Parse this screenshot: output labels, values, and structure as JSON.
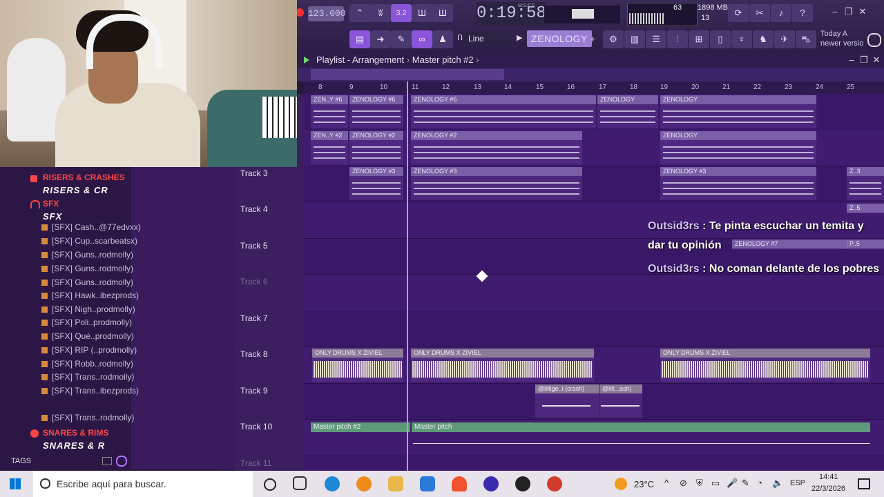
{
  "toolbar": {
    "tempo": "123.000",
    "time": "0:19:58",
    "time_unit": "M:S:CS",
    "pattern_btn": "3.2",
    "cpu": "63",
    "memory": "1898 MB",
    "polyphony": "13",
    "snap": "Line",
    "plugin": "ZENOLOGY",
    "news_line1": "Today  A",
    "news_line2": "newer versio"
  },
  "playlist": {
    "title": "Playlist - Arrangement",
    "pattern": "Master pitch #2",
    "ruler": [
      "8",
      "9",
      "10",
      "11",
      "12",
      "13",
      "14",
      "15",
      "16",
      "17",
      "18",
      "19",
      "20",
      "21",
      "22",
      "23",
      "24",
      "25"
    ],
    "tracks": [
      "Track 3",
      "Track 4",
      "Track 5",
      "Track 6",
      "Track 7",
      "Track 8",
      "Track 9",
      "Track 10",
      "Track 11"
    ],
    "clips": {
      "zen_y6": "ZEN..Y #6",
      "zenology6": "ZENOLOGY #6",
      "zenology": "ZENOLOGY",
      "zen_y2": "ZEN..Y #2",
      "zenology2": "ZENOLOGY #2",
      "zenology3": "ZENOLOGY #3",
      "z3": "Z..3",
      "z5": "Z..5",
      "zenology7": "ZENOLOGY #7",
      "p5": "P..5",
      "drums": "ONLY DRUMS X ZIVIEL",
      "crash": "@liltige..i (crash)",
      "lilt": "@lilt...ash)",
      "master2": "Master pitch #2",
      "master": "Master pitch"
    }
  },
  "chat": [
    {
      "user": "Outsid3rs",
      "text": " : Te pinta escuchar un temita y dar tu opinión"
    },
    {
      "user": "Outsid3rs",
      "text": " : No coman delante de los pobres"
    }
  ],
  "browser": {
    "cat1": "RISERS & CRASHES",
    "cat1_big": "RISERS & CR",
    "cat2": "SFX",
    "cat2_big": "SFX",
    "items": [
      "[SFX] Cash..@77edvxx)",
      "[SFX] Cup..scarbeatsx)",
      "[SFX] Guns..rodmolly)",
      "[SFX] Guns..rodmolly)",
      "[SFX] Guns..rodmolly)",
      "[SFX] Hawk..ibezprods)",
      "[SFX] Nigh..prodmolly)",
      "[SFX] Poli..prodmolly)",
      "[SFX] Qué..prodmolly)",
      "[SFX] RIP (..prodmolly)",
      "[SFX] Robb..rodmolly)",
      "[SFX] Trans..rodmolly)",
      "[SFX] Trans..ibezprods)",
      "[SFX] Trans..rodmolly)"
    ],
    "cat3": "SNARES & RIMS",
    "cat3_big": "SNARES & R",
    "tags": "TAGS"
  },
  "taskbar": {
    "search_placeholder": "Escribe aquí para buscar.",
    "temperature": "23°C",
    "language": "ESP",
    "clock_time": "14:41",
    "clock_date": "22/3/2026"
  }
}
